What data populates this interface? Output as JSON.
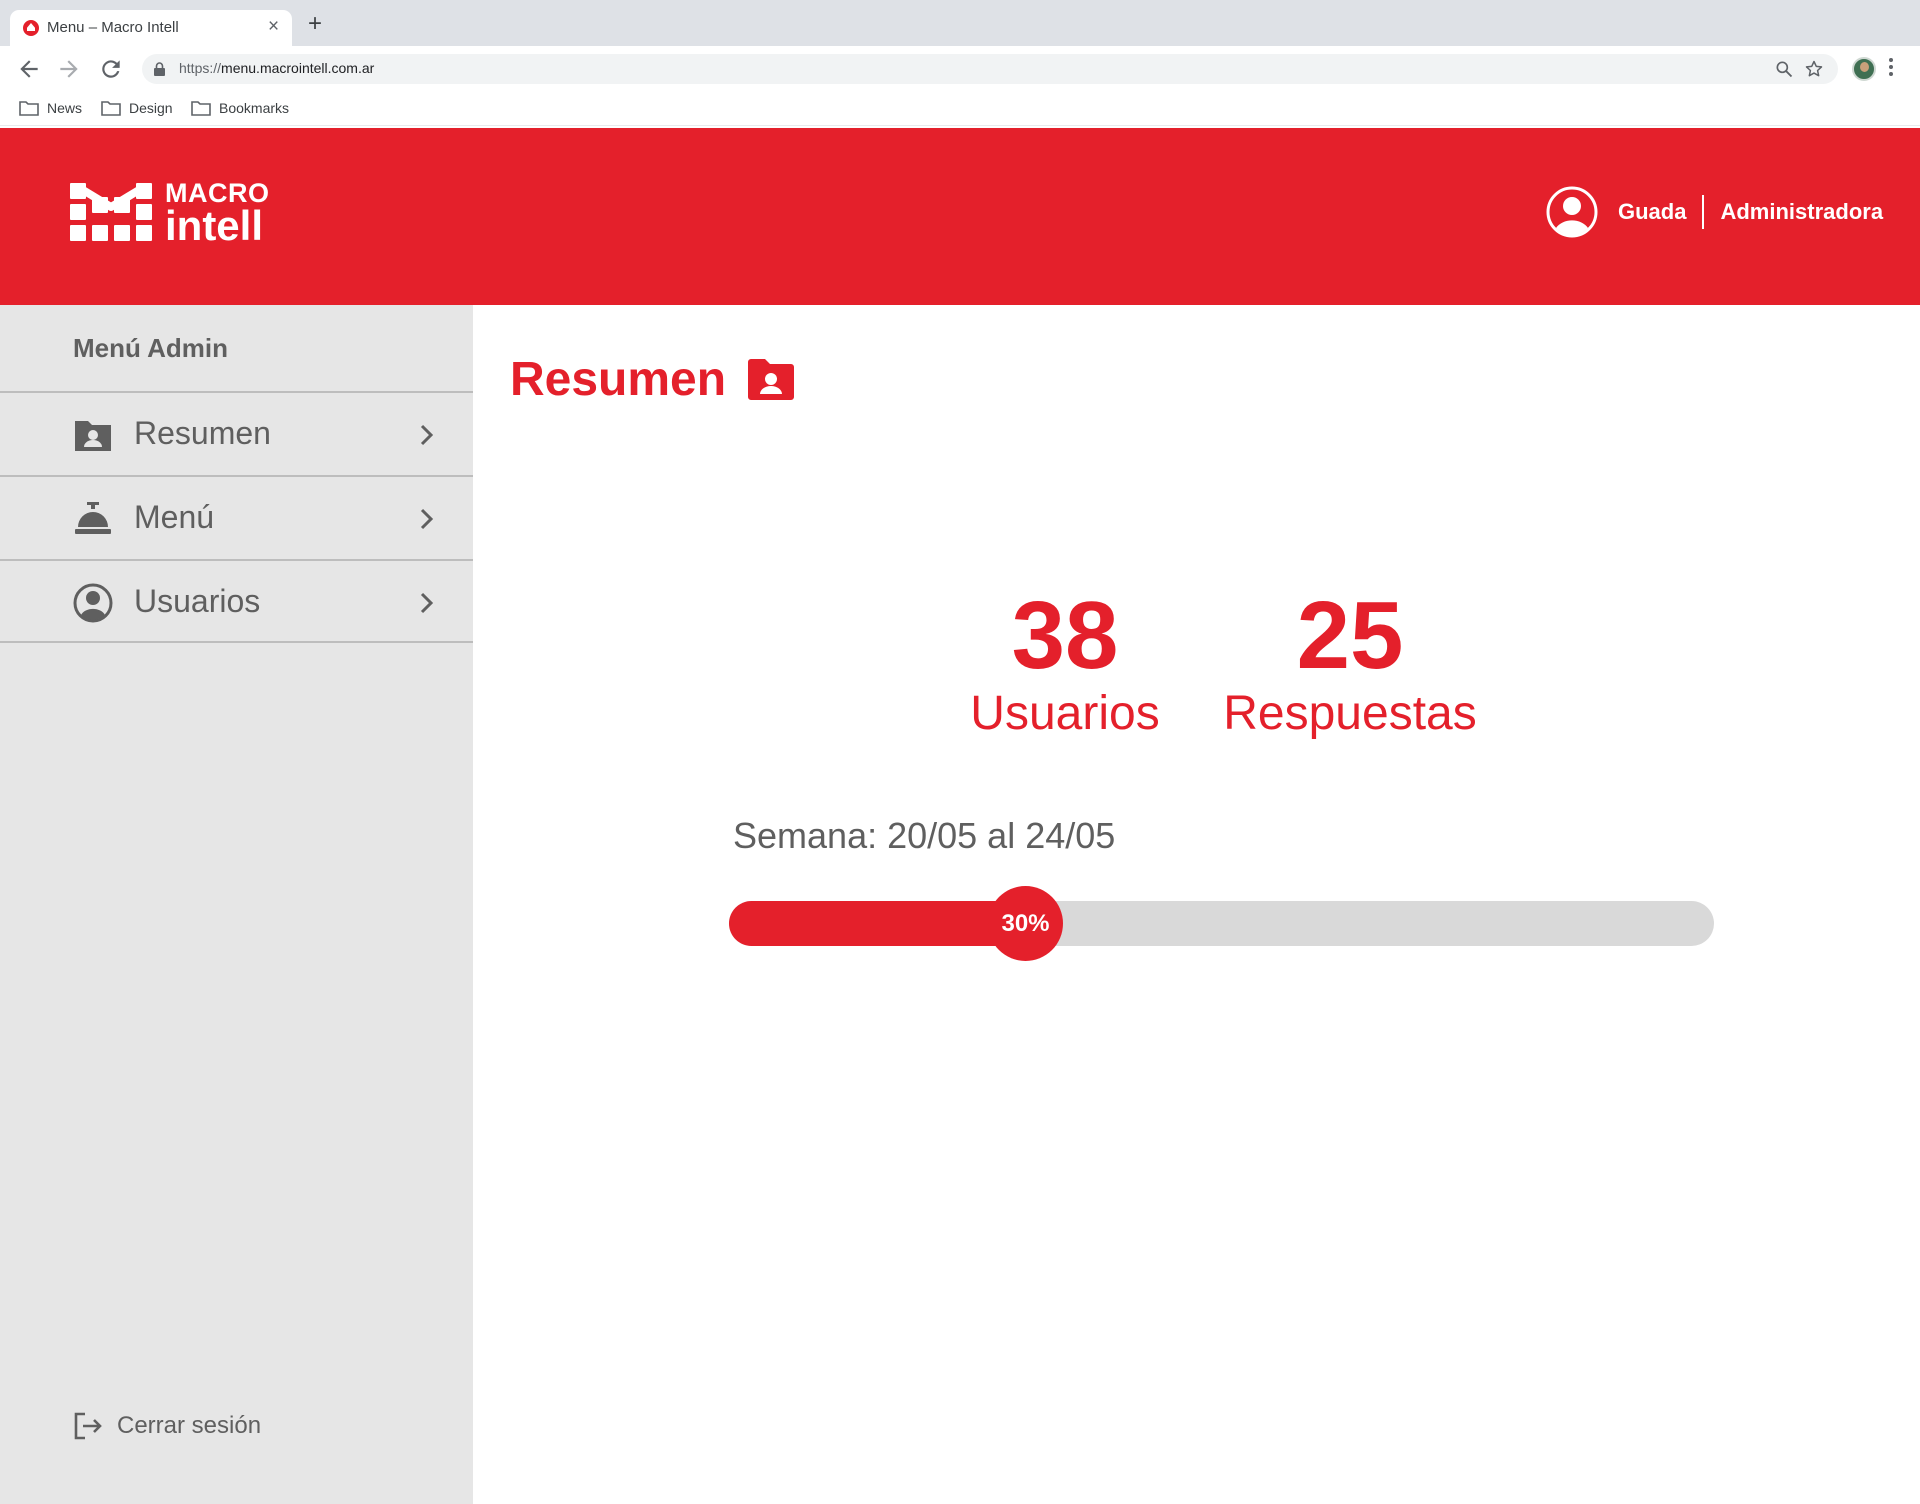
{
  "browser": {
    "tab_title": "Menu – Macro Intell",
    "close_glyph": "×",
    "new_tab_glyph": "+",
    "url_scheme": "https://",
    "url_host": "menu.macrointell.com.ar",
    "bookmarks": [
      {
        "label": "News",
        "icon": "folder-icon"
      },
      {
        "label": "Design",
        "icon": "folder-icon"
      },
      {
        "label": "Bookmarks",
        "icon": "folder-icon"
      }
    ]
  },
  "header": {
    "brand_top": "MACRO",
    "brand_bottom": "intell",
    "user_name": "Guada",
    "user_role": "Administradora",
    "colors": {
      "accent": "#e4202b",
      "text_on_accent": "#ffffff"
    }
  },
  "sidebar": {
    "title": "Menú Admin",
    "items": [
      {
        "label": "Resumen",
        "icon": "folder-user-icon"
      },
      {
        "label": "Menú",
        "icon": "service-bell-icon"
      },
      {
        "label": "Usuarios",
        "icon": "user-circle-icon"
      }
    ],
    "logout_label": "Cerrar sesión",
    "colors": {
      "background": "#e6e6e6",
      "text": "#5f5f5f",
      "divider": "#bdbdbd"
    }
  },
  "main": {
    "title": "Resumen",
    "stats": [
      {
        "value": "38",
        "label": "Usuarios"
      },
      {
        "value": "25",
        "label": "Respuestas"
      }
    ],
    "week_label": "Semana: 20/05 al 24/05",
    "progress": {
      "percent": 30,
      "label": "30%"
    },
    "colors": {
      "accent": "#e4202b",
      "track": "#d9d9d9"
    }
  }
}
